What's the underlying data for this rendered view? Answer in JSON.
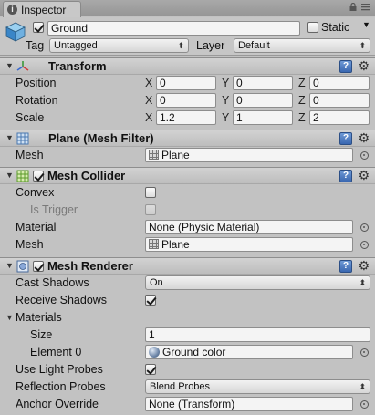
{
  "window": {
    "tab_label": "Inspector",
    "tab_icon": "info-icon",
    "controls": [
      "lock-icon",
      "menu-icon"
    ]
  },
  "object": {
    "enabled": true,
    "name": "Ground",
    "static_label": "Static",
    "static_checked": false,
    "tag_label": "Tag",
    "tag_value": "Untagged",
    "layer_label": "Layer",
    "layer_value": "Default"
  },
  "transform": {
    "title": "Transform",
    "position_label": "Position",
    "rotation_label": "Rotation",
    "scale_label": "Scale",
    "axis_x": "X",
    "axis_y": "Y",
    "axis_z": "Z",
    "position": [
      "0",
      "0",
      "0"
    ],
    "rotation": [
      "0",
      "0",
      "0"
    ],
    "scale": [
      "1.2",
      "1",
      "2"
    ]
  },
  "mesh_filter": {
    "title": "Plane (Mesh Filter)",
    "mesh_label": "Mesh",
    "mesh_value": "Plane"
  },
  "mesh_collider": {
    "title": "Mesh Collider",
    "enabled": true,
    "convex_label": "Convex",
    "convex_checked": false,
    "is_trigger_label": "Is Trigger",
    "is_trigger_checked": false,
    "material_label": "Material",
    "material_value": "None (Physic Material)",
    "mesh_label": "Mesh",
    "mesh_value": "Plane"
  },
  "mesh_renderer": {
    "title": "Mesh Renderer",
    "enabled": true,
    "cast_shadows_label": "Cast Shadows",
    "cast_shadows_value": "On",
    "receive_shadows_label": "Receive Shadows",
    "receive_shadows_checked": true,
    "materials_label": "Materials",
    "size_label": "Size",
    "size_value": "1",
    "element0_label": "Element 0",
    "element0_value": "Ground color",
    "use_light_probes_label": "Use Light Probes",
    "use_light_probes_checked": true,
    "reflection_probes_label": "Reflection Probes",
    "reflection_probes_value": "Blend Probes",
    "anchor_override_label": "Anchor Override",
    "anchor_override_value": "None (Transform)"
  },
  "colors": {
    "panel_bg": "#c2c2c2",
    "header_bg": "#c6c6c6",
    "help_blue": "#3a67b0"
  }
}
